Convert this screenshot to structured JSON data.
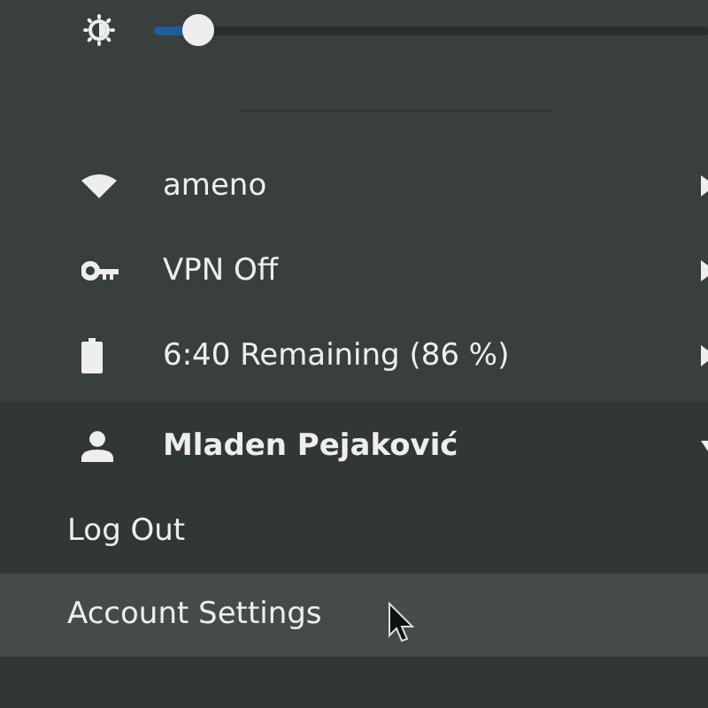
{
  "brightness": {
    "level": 0.08
  },
  "items": [
    {
      "kind": "wifi",
      "label": "ameno"
    },
    {
      "kind": "vpn",
      "label": "VPN Off"
    },
    {
      "kind": "battery",
      "label": "6:40 Remaining (86 %)"
    }
  ],
  "user": {
    "name": "Mladen Pejaković",
    "expanded": true,
    "submenu": [
      {
        "label": "Log Out",
        "selected": false
      },
      {
        "label": "Account Settings",
        "selected": true
      }
    ]
  }
}
